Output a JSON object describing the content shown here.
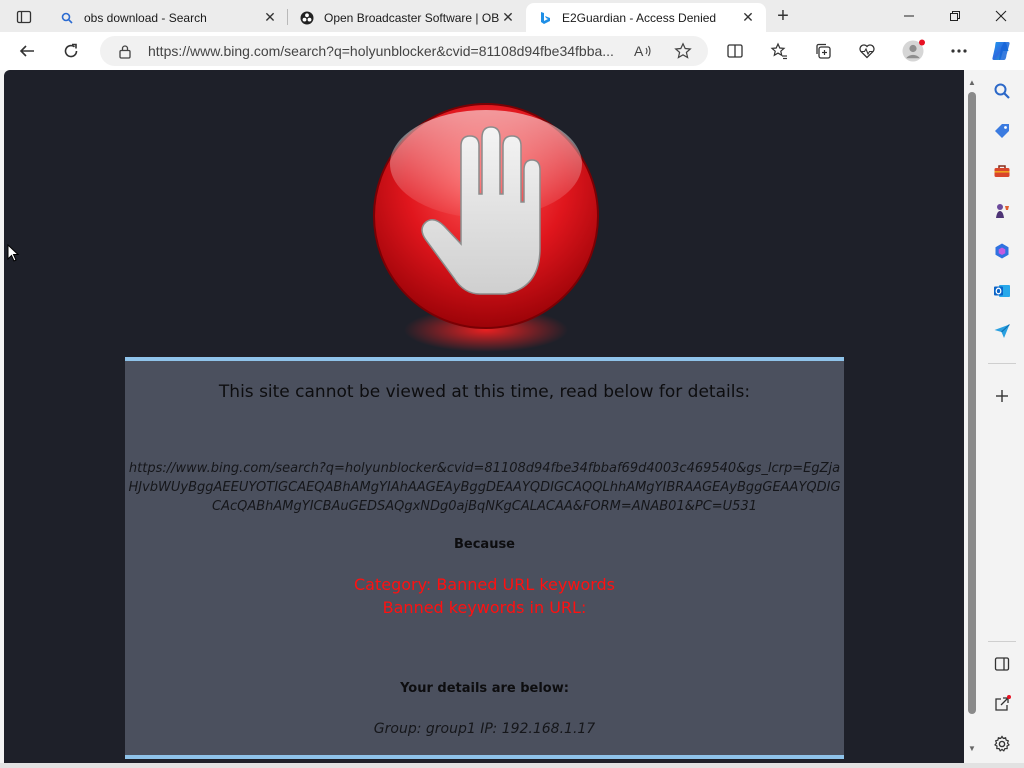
{
  "tabs": [
    {
      "title": "obs download - Search",
      "close": "✕",
      "icon": "search-icon"
    },
    {
      "title": "Open Broadcaster Software | OBS",
      "close": "✕",
      "icon": "obs-logo-icon"
    },
    {
      "title": "E2Guardian - Access Denied",
      "close": "✕",
      "icon": "bing-logo-icon",
      "active": true
    }
  ],
  "new_tab": "+",
  "address_bar": {
    "url": "https://www.bing.com/search?q=holyunblocker&cvid=81108d94fbe34fbba..."
  },
  "page": {
    "heading": "This site cannot be viewed at this time, read below for details:",
    "blocked_url": "https://www.bing.com/search?q=holyunblocker&cvid=81108d94fbe34fbbaf69d4003c469540&gs_lcrp=EgZjaHJvbWUyBggAEEUYOTIGCAEQABhAMgYIAhAAGEAyBggDEAAYQDIGCAQQLhhAMgYIBRAAGEAyBggGEAAYQDIGCAcQABhAMgYICBAuGEDSAQgxNDg0ajBqNKgCALACAA&FORM=ANAB01&PC=U531",
    "because_label": "Because",
    "category": "Category: Banned URL keywords",
    "keywords": "Banned keywords in URL:",
    "details_label": "Your details are below:",
    "group_info": "Group: group1   IP: 192.168.1.17"
  },
  "colors": {
    "page_bg": "#1e2029",
    "box_bg": "#4b505e",
    "box_border": "#8fc3ea",
    "reason_text": "#ff1010",
    "stop_red": "#d8141c"
  }
}
